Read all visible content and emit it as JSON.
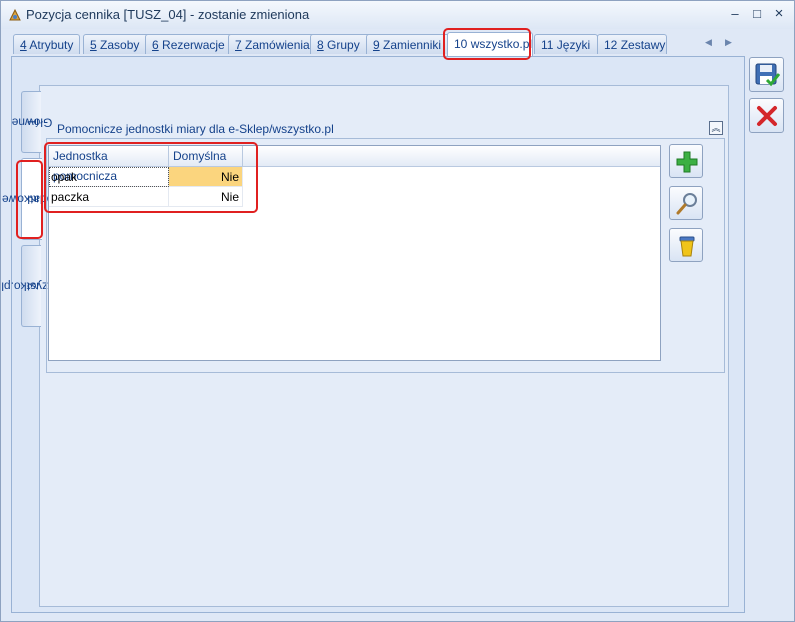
{
  "window": {
    "title": "Pozycja cennika [TUSZ_04] - zostanie zmieniona",
    "controls": [
      "–",
      "□",
      "×"
    ]
  },
  "top_tabs": [
    {
      "num": "4",
      "label": " Atrybuty"
    },
    {
      "num": "5",
      "label": " Zasoby"
    },
    {
      "num": "6",
      "label": " Rezerwacje"
    },
    {
      "num": "7",
      "label": " Zamówienia"
    },
    {
      "num": "8",
      "label": " Grupy"
    },
    {
      "num": "9",
      "label": " Zamienniki"
    },
    {
      "num": "10",
      "label": " wszystko.pl"
    },
    {
      "num": "11",
      "label": " Języki"
    },
    {
      "num": "12",
      "label": " Zestawy"
    }
  ],
  "tab_scroll": {
    "left": "◀",
    "right": "▶"
  },
  "vertical_tabs": [
    {
      "num": "1",
      "label": " Główne"
    },
    {
      "num": "2",
      "label": " Dodatkowe"
    },
    {
      "num": "3",
      "label": " wszystko.pl"
    }
  ],
  "group": {
    "title": "Pomocnicze jednostki miary dla e-Sklep/wszystko.pl",
    "collapse_glyph": "⌃"
  },
  "grid": {
    "columns": [
      "Jednostka pomocnicza",
      "Domyślna"
    ],
    "rows": [
      {
        "unit": "opak",
        "default": "Nie"
      },
      {
        "unit": "paczka",
        "default": "Nie"
      }
    ]
  },
  "icons": {
    "add": "plus-icon",
    "edit": "magnifier-icon",
    "delete": "trash-icon",
    "save": "save-icon",
    "cancel": "close-icon"
  },
  "colors": {
    "accent": "#15428b",
    "highlight": "#fbd57e",
    "annotation": "#e02020"
  }
}
